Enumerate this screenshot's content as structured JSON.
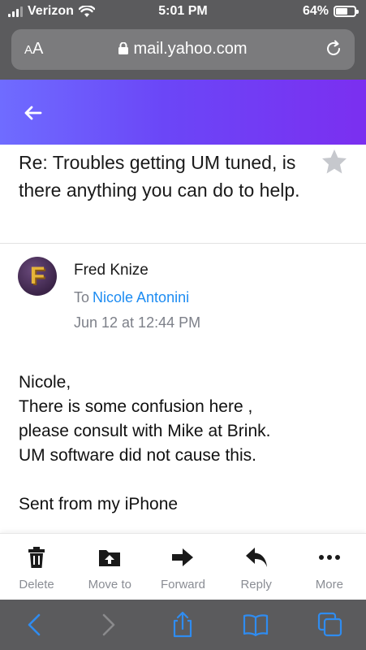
{
  "status_bar": {
    "carrier": "Verizon",
    "time": "5:01 PM",
    "battery_percent": "64%",
    "battery_level": 0.64
  },
  "browser": {
    "text_size_label_small": "A",
    "text_size_label_large": "A",
    "url": "mail.yahoo.com"
  },
  "email": {
    "subject": "Re: Troubles getting UM tuned, is there anything you can do to help.",
    "sender_initial": "F",
    "sender_name": "Fred Knize",
    "to_label": "To",
    "recipient": "Nicole Antonini",
    "date": "Jun 12 at 12:44 PM",
    "body_lines": [
      "Nicole,",
      "There is some confusion here ,",
      "please consult with Mike at Brink.",
      "UM software did not cause this.",
      "",
      "Sent from my iPhone"
    ]
  },
  "actions": {
    "delete": "Delete",
    "move_to": "Move to",
    "forward": "Forward",
    "reply": "Reply",
    "more": "More"
  },
  "colors": {
    "header_gradient_start": "#6f6cff",
    "header_gradient_end": "#7b2ff0",
    "link_blue": "#1d8cf2",
    "safari_icon_blue": "#2f8cf0"
  }
}
